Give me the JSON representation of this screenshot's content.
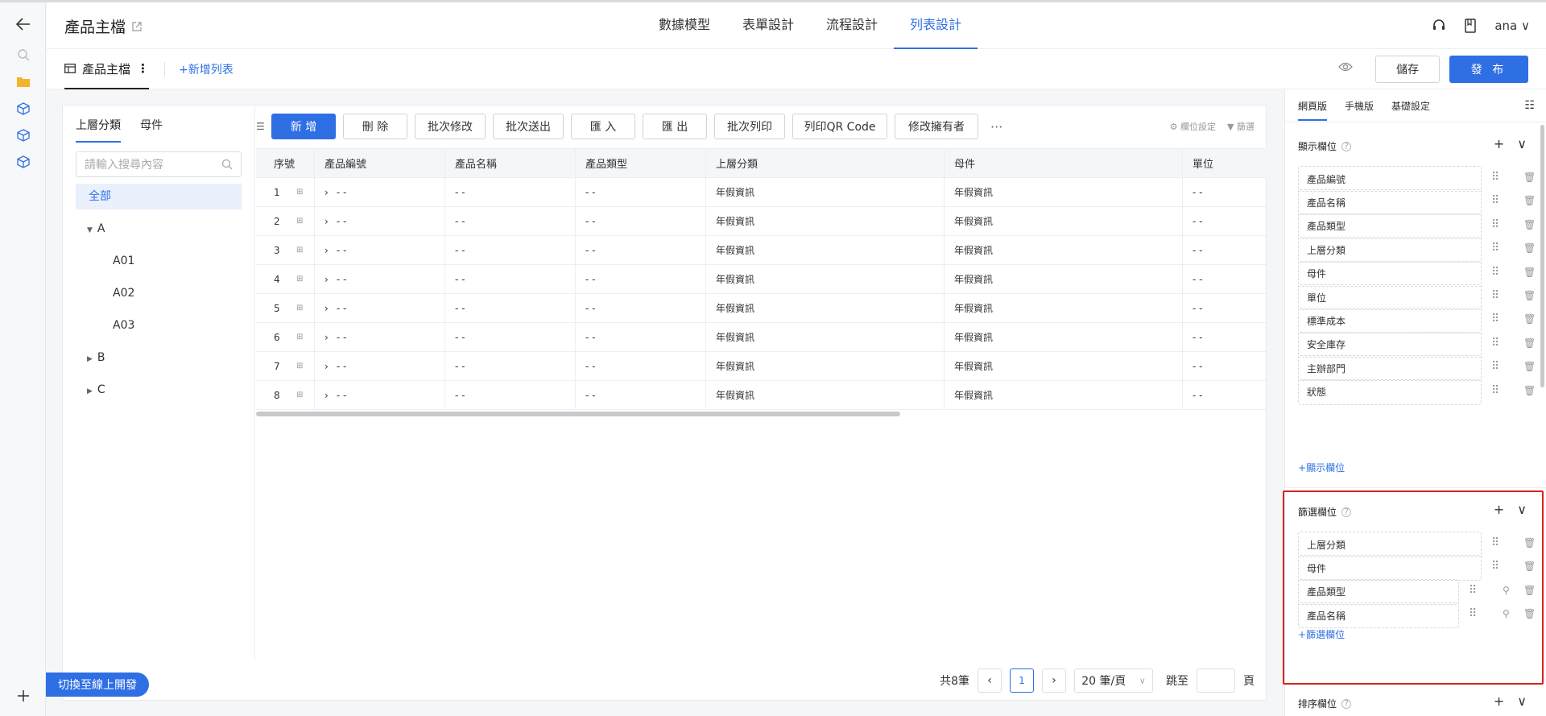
{
  "header": {
    "title": "產品主檔",
    "tabs": [
      {
        "label": "數據模型"
      },
      {
        "label": "表單設計"
      },
      {
        "label": "流程設計"
      },
      {
        "label": "列表設計"
      }
    ],
    "user": "ana"
  },
  "subheader": {
    "list_name": "產品主檔",
    "add_list": "新增列表",
    "save": "儲存",
    "publish": "發 布"
  },
  "tree": {
    "tabs": [
      "上層分類",
      "母件"
    ],
    "search_placeholder": "請輸入搜尋內容",
    "items": [
      {
        "label": "全部"
      },
      {
        "label": "A"
      },
      {
        "label": "A01"
      },
      {
        "label": "A02"
      },
      {
        "label": "A03"
      },
      {
        "label": "B"
      },
      {
        "label": "C"
      }
    ]
  },
  "toolbar": {
    "buttons": [
      "新 增",
      "刪 除",
      "批次修改",
      "批次送出",
      "匯 入",
      "匯 出",
      "批次列印",
      "列印QR Code",
      "修改擁有者"
    ],
    "more": "···",
    "column_settings": "欄位設定",
    "filter": "篩選"
  },
  "table": {
    "columns": [
      "序號",
      "產品編號",
      "產品名稱",
      "產品類型",
      "上層分類",
      "母件",
      "單位"
    ],
    "rows": [
      {
        "no": "1",
        "code": "- -",
        "name": "- -",
        "type": "- -",
        "category": "年假資訊",
        "parent": "年假資訊",
        "unit": "- -"
      },
      {
        "no": "2",
        "code": "- -",
        "name": "- -",
        "type": "- -",
        "category": "年假資訊",
        "parent": "年假資訊",
        "unit": "- -"
      },
      {
        "no": "3",
        "code": "- -",
        "name": "- -",
        "type": "- -",
        "category": "年假資訊",
        "parent": "年假資訊",
        "unit": "- -"
      },
      {
        "no": "4",
        "code": "- -",
        "name": "- -",
        "type": "- -",
        "category": "年假資訊",
        "parent": "年假資訊",
        "unit": "- -"
      },
      {
        "no": "5",
        "code": "- -",
        "name": "- -",
        "type": "- -",
        "category": "年假資訊",
        "parent": "年假資訊",
        "unit": "- -"
      },
      {
        "no": "6",
        "code": "- -",
        "name": "- -",
        "type": "- -",
        "category": "年假資訊",
        "parent": "年假資訊",
        "unit": "- -"
      },
      {
        "no": "7",
        "code": "- -",
        "name": "- -",
        "type": "- -",
        "category": "年假資訊",
        "parent": "年假資訊",
        "unit": "- -"
      },
      {
        "no": "8",
        "code": "- -",
        "name": "- -",
        "type": "- -",
        "category": "年假資訊",
        "parent": "年假資訊",
        "unit": "- -"
      }
    ]
  },
  "pager": {
    "total": "共8筆",
    "current": "1",
    "page_size": "20 筆/頁",
    "goto": "跳至",
    "page_unit": "頁"
  },
  "switch_label": "切換至線上開發",
  "panel": {
    "tabs": [
      "網頁版",
      "手機版",
      "基礎設定"
    ],
    "display": {
      "title": "顯示欄位",
      "fields": [
        "產品編號",
        "產品名稱",
        "產品類型",
        "上層分類",
        "母件",
        "單位",
        "標準成本",
        "安全庫存",
        "主辦部門",
        "狀態"
      ],
      "add": "顯示欄位"
    },
    "filter": {
      "title": "篩選欄位",
      "fields": [
        "上層分類",
        "母件",
        "產品類型",
        "產品名稱"
      ],
      "add": "篩選欄位"
    },
    "sort": {
      "title": "排序欄位"
    }
  }
}
